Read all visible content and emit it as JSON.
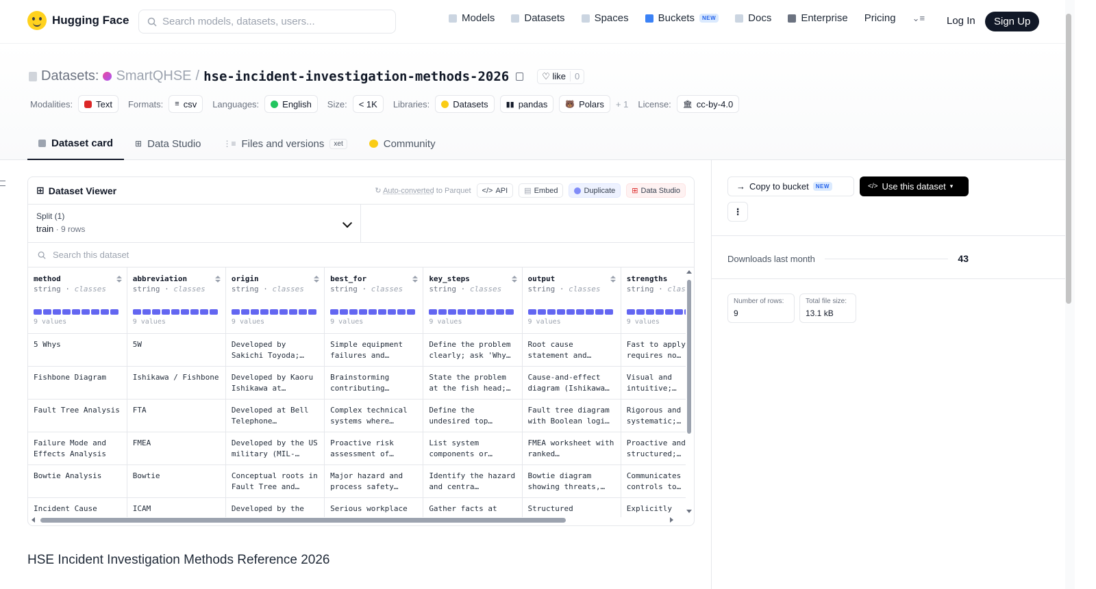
{
  "header": {
    "brand": "Hugging Face",
    "search_placeholder": "Search models, datasets, users...",
    "nav": [
      {
        "label": "Models"
      },
      {
        "label": "Datasets"
      },
      {
        "label": "Spaces"
      },
      {
        "label": "Buckets",
        "badge": "NEW"
      },
      {
        "label": "Docs"
      },
      {
        "label": "Enterprise"
      },
      {
        "label": "Pricing"
      }
    ],
    "login": "Log In",
    "signup": "Sign Up"
  },
  "dataset": {
    "section_label": "Datasets:",
    "org": "SmartQHSE",
    "separator": "/",
    "name": "hse-incident-investigation-methods-2026",
    "like_label": "like",
    "like_count": "0",
    "tags": {
      "modalities_label": "Modalities:",
      "modality": "Text",
      "formats_label": "Formats:",
      "format": "csv",
      "languages_label": "Languages:",
      "language": "English",
      "size_label": "Size:",
      "size": "< 1K",
      "libraries_label": "Libraries:",
      "lib1": "Datasets",
      "lib2": "pandas",
      "lib3": "Polars",
      "lib_more": "+ 1",
      "license_label": "License:",
      "license": "cc-by-4.0"
    },
    "tabs": [
      {
        "label": "Dataset card"
      },
      {
        "label": "Data Studio"
      },
      {
        "label": "Files and versions",
        "badge": "xet"
      },
      {
        "label": "Community"
      }
    ]
  },
  "viewer": {
    "title": "Dataset Viewer",
    "note_link": "Auto-converted",
    "note_rest": " to Parquet",
    "btn_api": "API",
    "btn_embed": "Embed",
    "btn_duplicate": "Duplicate",
    "btn_studio": "Data Studio",
    "split_caption": "Split (1)",
    "split_value": "train",
    "split_rows": "9 rows",
    "search_placeholder": "Search this dataset",
    "columns": [
      {
        "name": "method",
        "type": "string",
        "kind": "classes",
        "values": "9 values"
      },
      {
        "name": "abbreviation",
        "type": "string",
        "kind": "classes",
        "values": "9 values"
      },
      {
        "name": "origin",
        "type": "string",
        "kind": "classes",
        "values": "9 values"
      },
      {
        "name": "best_for",
        "type": "string",
        "kind": "classes",
        "values": "9 values"
      },
      {
        "name": "key_steps",
        "type": "string",
        "kind": "classes",
        "values": "9 values"
      },
      {
        "name": "output",
        "type": "string",
        "kind": "classes",
        "values": "9 values"
      },
      {
        "name": "strengths",
        "type": "string",
        "kind": "classes",
        "values": "9 values"
      }
    ],
    "rows": [
      [
        "5 Whys",
        "5W",
        "Developed by Sakichi Toyoda;…",
        "Simple equipment failures and…",
        "Define the problem clearly; ask 'Why…",
        "Root cause statement and…",
        "Fast to apply; requires no…"
      ],
      [
        "Fishbone Diagram",
        "Ishikawa / Fishbone",
        "Developed by Kaoru Ishikawa at…",
        "Brainstorming contributing…",
        "State the problem at the fish head;…",
        "Cause-and-effect diagram (Ishikawa…",
        "Visual and intuitive;…"
      ],
      [
        "Fault Tree Analysis",
        "FTA",
        "Developed at Bell Telephone…",
        "Complex technical systems where…",
        "Define the undesired top…",
        "Fault tree diagram with Boolean logi…",
        "Rigorous and systematic;…"
      ],
      [
        "Failure Mode and Effects Analysis",
        "FMEA",
        "Developed by the US military (MIL-…",
        "Proactive risk assessment of…",
        "List system components or…",
        "FMEA worksheet with ranked…",
        "Proactive and structured;…"
      ],
      [
        "Bowtie Analysis",
        "Bowtie",
        "Conceptual roots in Fault Tree and…",
        "Major hazard and process safety…",
        "Identify the hazard and centra…",
        "Bowtie diagram showing threats,…",
        "Communicates controls to…"
      ],
      [
        "Incident Cause",
        "ICAM",
        "Developed by the",
        "Serious workplace",
        "Gather facts at",
        "Structured",
        "Explicitly"
      ]
    ]
  },
  "side": {
    "copy_label": "Copy to bucket",
    "copy_badge": "NEW",
    "use_label": "Use this dataset",
    "more": "⋮",
    "downloads_label": "Downloads last month",
    "downloads_value": "43",
    "rows_label": "Number of rows:",
    "rows_value": "9",
    "size_label": "Total file size:",
    "size_value": "13.1 kB"
  },
  "card": {
    "heading": "HSE Incident Investigation Methods Reference 2026"
  },
  "icons": {
    "search": "search-icon",
    "like": "heart-icon",
    "copy": "copy-icon"
  }
}
